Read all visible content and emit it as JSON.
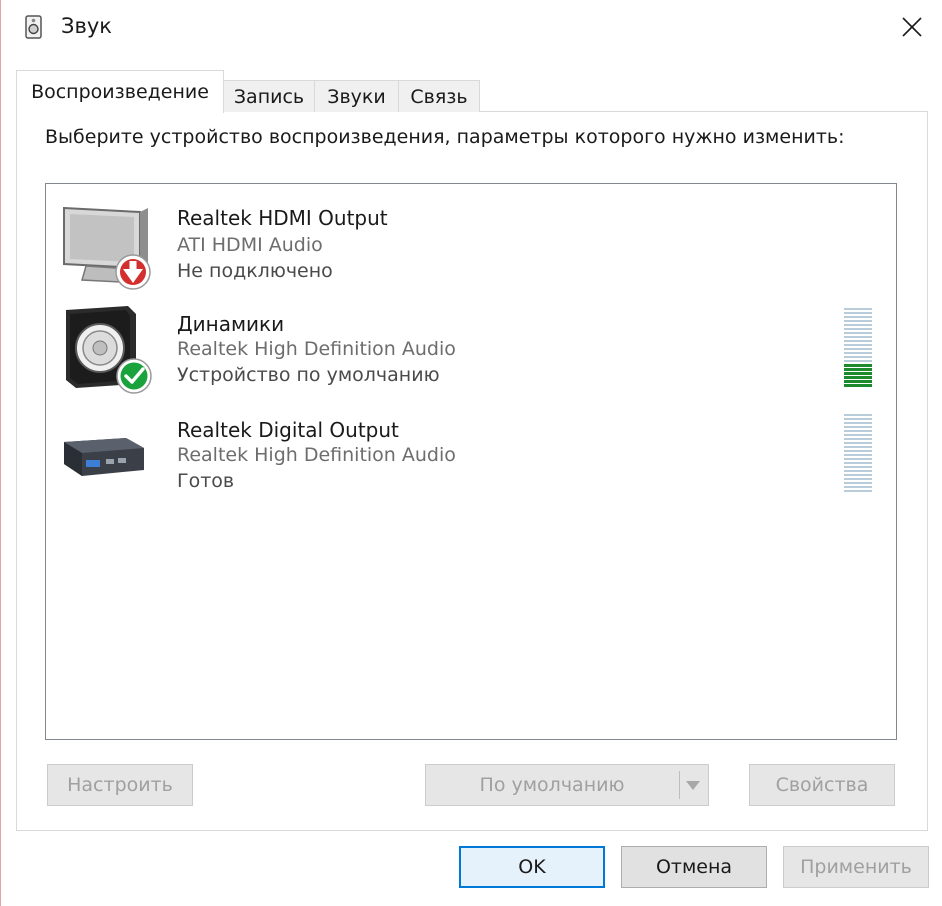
{
  "window": {
    "title": "Звук",
    "icon": "speaker-icon",
    "close_icon": "close-icon"
  },
  "tabs": [
    {
      "label": "Воспроизведение",
      "active": true
    },
    {
      "label": "Запись",
      "active": false
    },
    {
      "label": "Звуки",
      "active": false
    },
    {
      "label": "Связь",
      "active": false
    }
  ],
  "instruction": "Выберите устройство воспроизведения, параметры которого нужно изменить:",
  "devices": [
    {
      "name": "Realtek HDMI Output",
      "driver": "ATI HDMI Audio",
      "status": "Не подключено",
      "icon": "monitor-icon",
      "badge": "disconnected-down-arrow-icon",
      "level_meter": false
    },
    {
      "name": "Динамики",
      "driver": "Realtek High Definition Audio",
      "status": "Устройство по умолчанию",
      "icon": "speaker-box-icon",
      "badge": "default-checkmark-icon",
      "level_meter": true,
      "level_active_fraction": 0.3
    },
    {
      "name": "Realtek Digital Output",
      "driver": "Realtek High Definition Audio",
      "status": "Готов",
      "icon": "digital-receiver-icon",
      "level_meter": true,
      "level_active_fraction": 0
    }
  ],
  "buttons": {
    "configure": "Настроить",
    "set_default": "По умолчанию",
    "properties": "Свойства",
    "ok": "OK",
    "cancel": "Отмена",
    "apply": "Применить"
  },
  "colors": {
    "accent": "#0078d7",
    "meter_active": "#1e8a2e",
    "meter_inactive": "#b9ccd9",
    "badge_red": "#d32f2f",
    "badge_green": "#1aa33c"
  }
}
